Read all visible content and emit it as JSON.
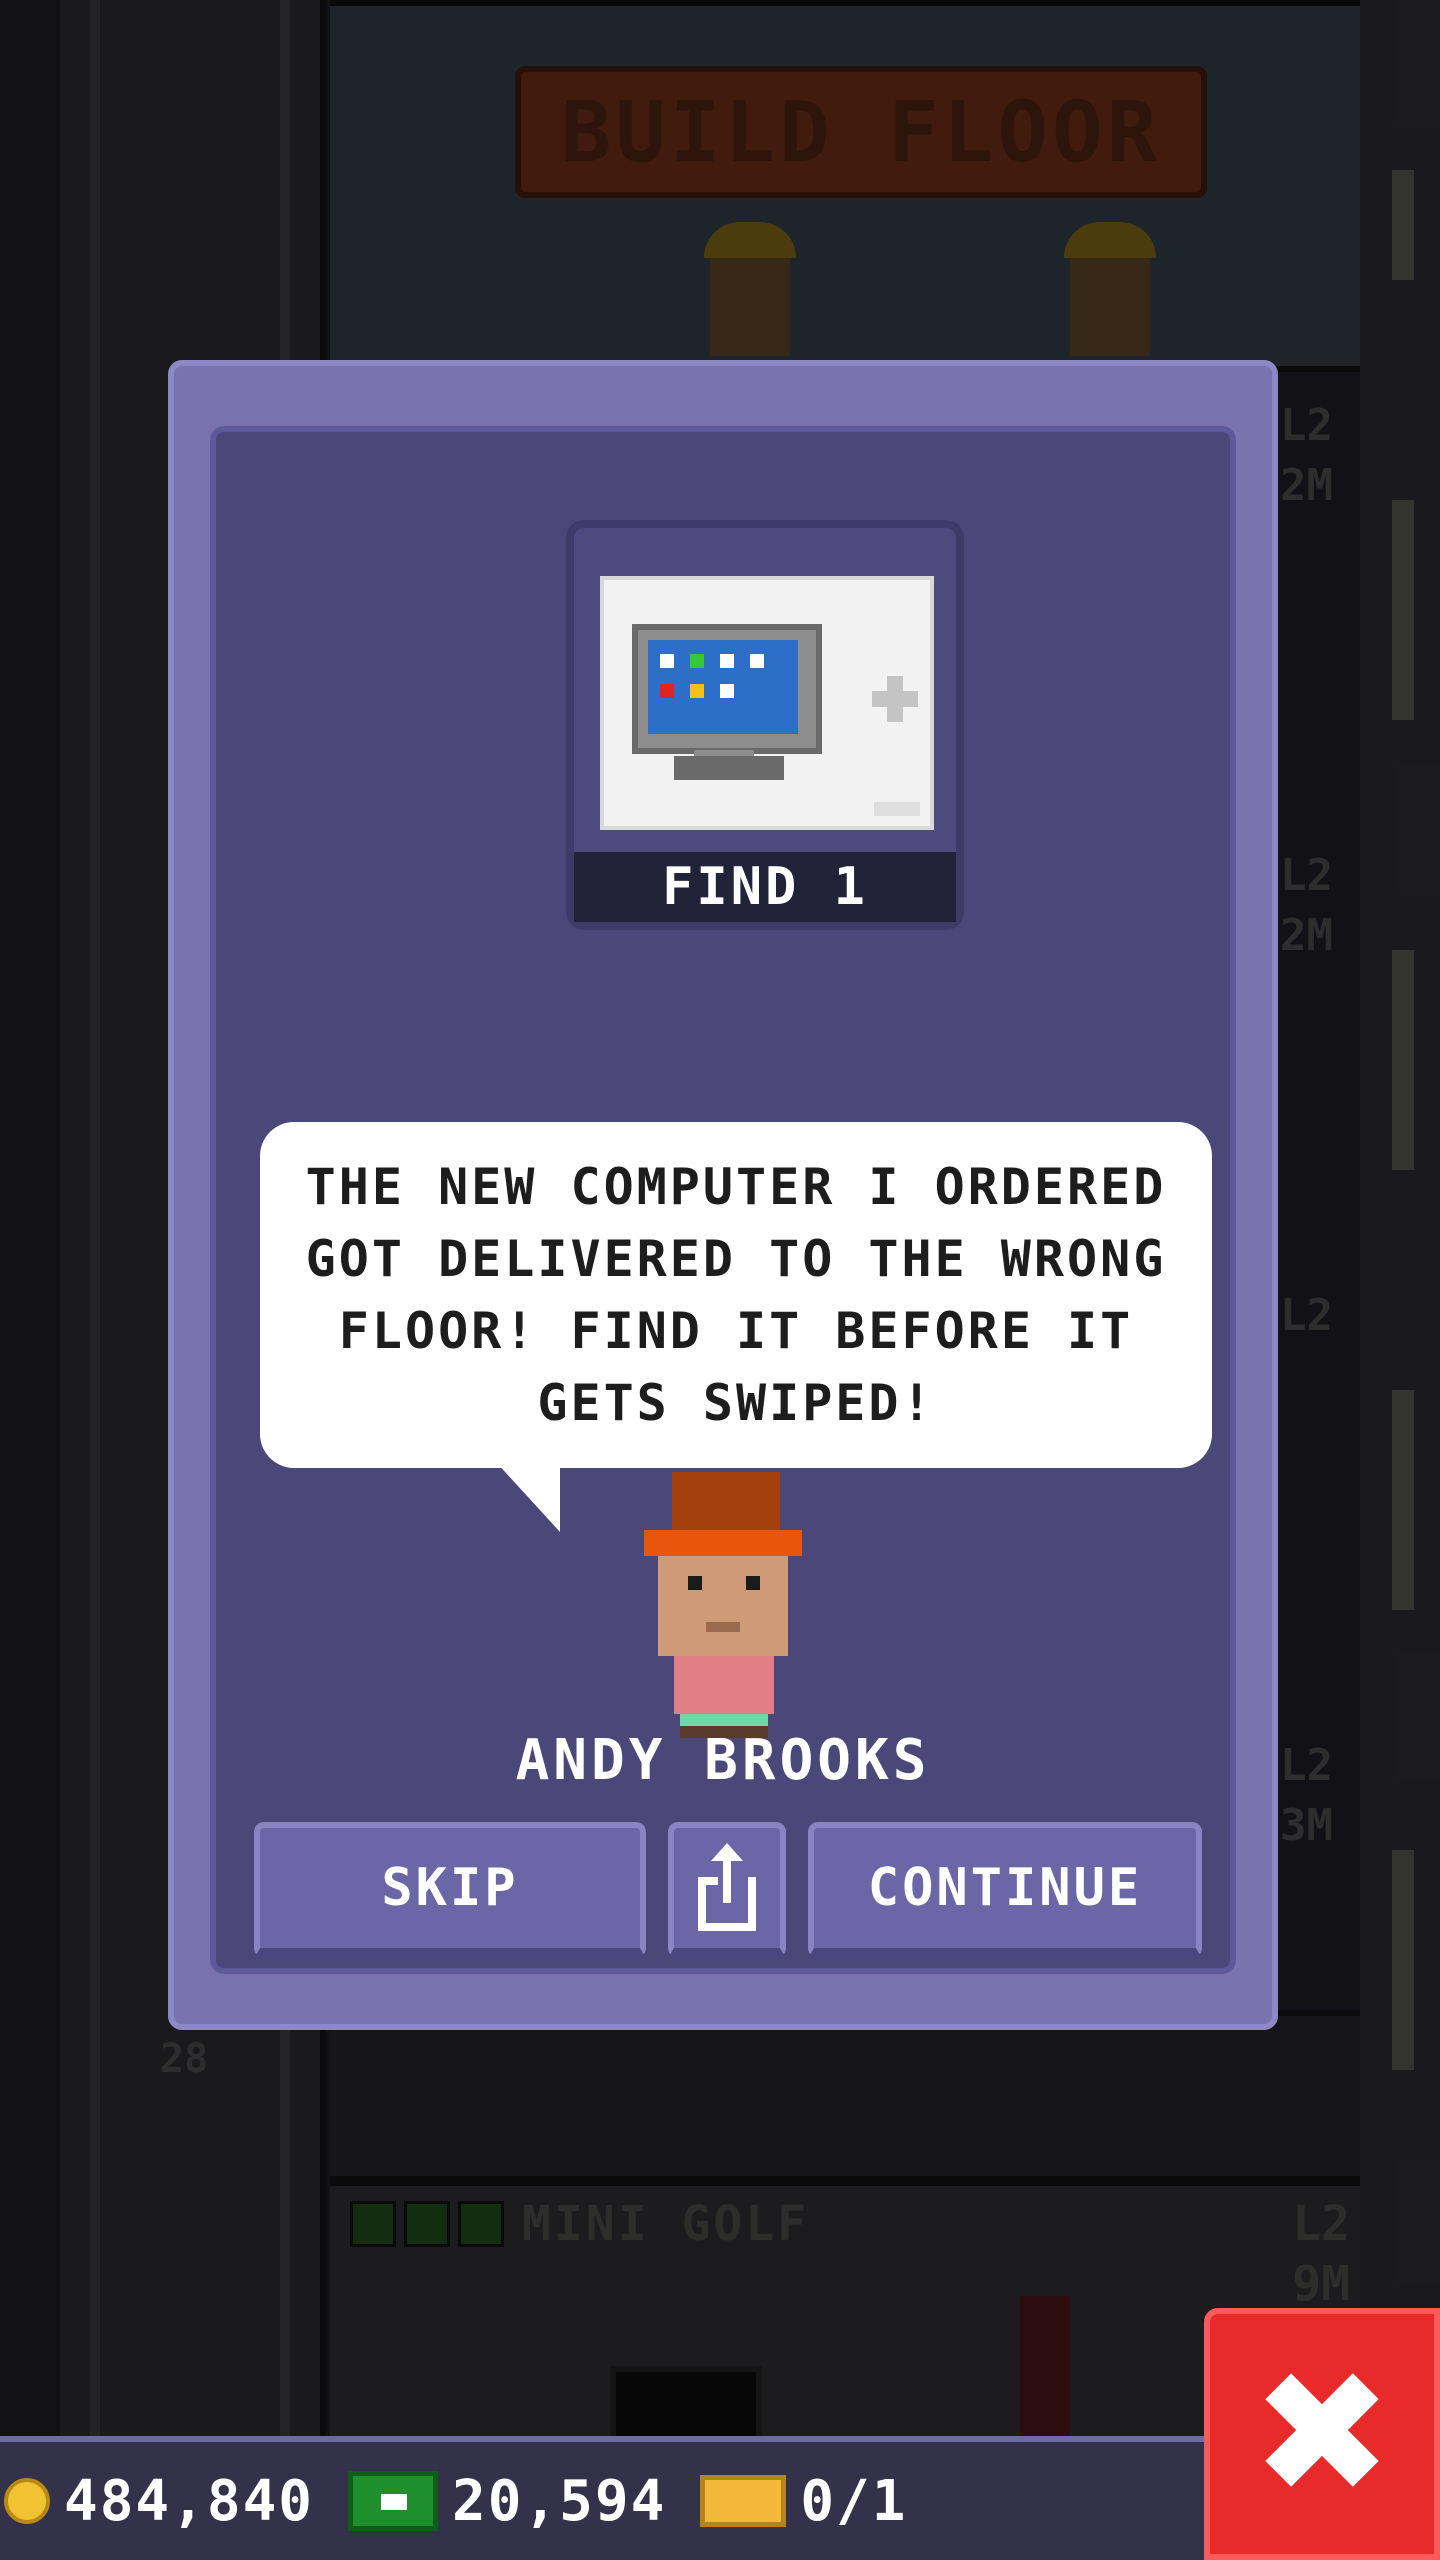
{
  "background": {
    "floor_sign": "BUILD FLOOR",
    "golf_floor_name": "MINI GOLF",
    "golf_floor_level": "L2",
    "golf_floor_height": "9M",
    "side_tags": [
      "L2",
      "2M",
      "L2",
      "2M",
      "L2",
      "L2",
      "3M"
    ],
    "lower_floor_number": "28"
  },
  "modal": {
    "find_label": "FIND 1",
    "find_item": "computer",
    "dialog_text": "THE NEW COMPUTER I ORDERED GOT DELIVERED TO THE WRONG FLOOR! FIND IT BEFORE IT GETS SWIPED!",
    "character_name": "ANDY BROOKS",
    "buttons": {
      "skip": "SKIP",
      "continue": "CONTINUE"
    }
  },
  "status_bar": {
    "coins": "484,840",
    "tower_bux": "20,594",
    "tickets": "0/1"
  },
  "icons": {
    "coin": "coin-icon",
    "bux": "tower-bux-icon",
    "ticket": "ticket-icon",
    "share": "share-icon",
    "close": "close-icon"
  },
  "colors": {
    "modal_outer": "#7b73b0",
    "modal_inner": "#4b4778",
    "button": "#6c66a6",
    "close_button": "#e82a2a"
  }
}
